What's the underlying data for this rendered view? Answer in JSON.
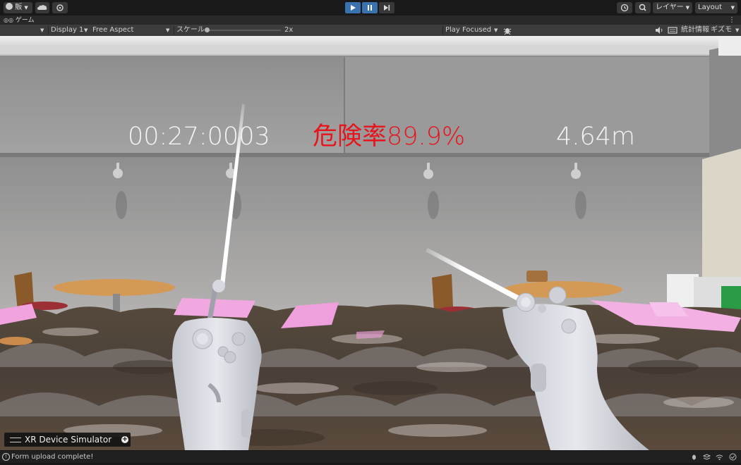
{
  "toolbar": {
    "account_label": "販",
    "layers_label": "レイヤー",
    "layout_label": "Layout"
  },
  "tab": {
    "title": "ゲーム"
  },
  "game_bar": {
    "display_label": "Display 1",
    "aspect_label": "Free Aspect",
    "scale_label": "スケール",
    "scale_value": "2x",
    "play_mode_label": "Play Focused",
    "stats_label": "統計情報",
    "gizmos_label": "ギズモ"
  },
  "hud": {
    "timer": "00:27:0003",
    "danger": "危険率89.9%",
    "distance": "4.64m",
    "danger_color": "#e8141c"
  },
  "xr_panel": {
    "title": "XR Device Simulator"
  },
  "status": {
    "message": "Form upload complete!"
  },
  "colors": {
    "play_active": "#3a72b0"
  }
}
